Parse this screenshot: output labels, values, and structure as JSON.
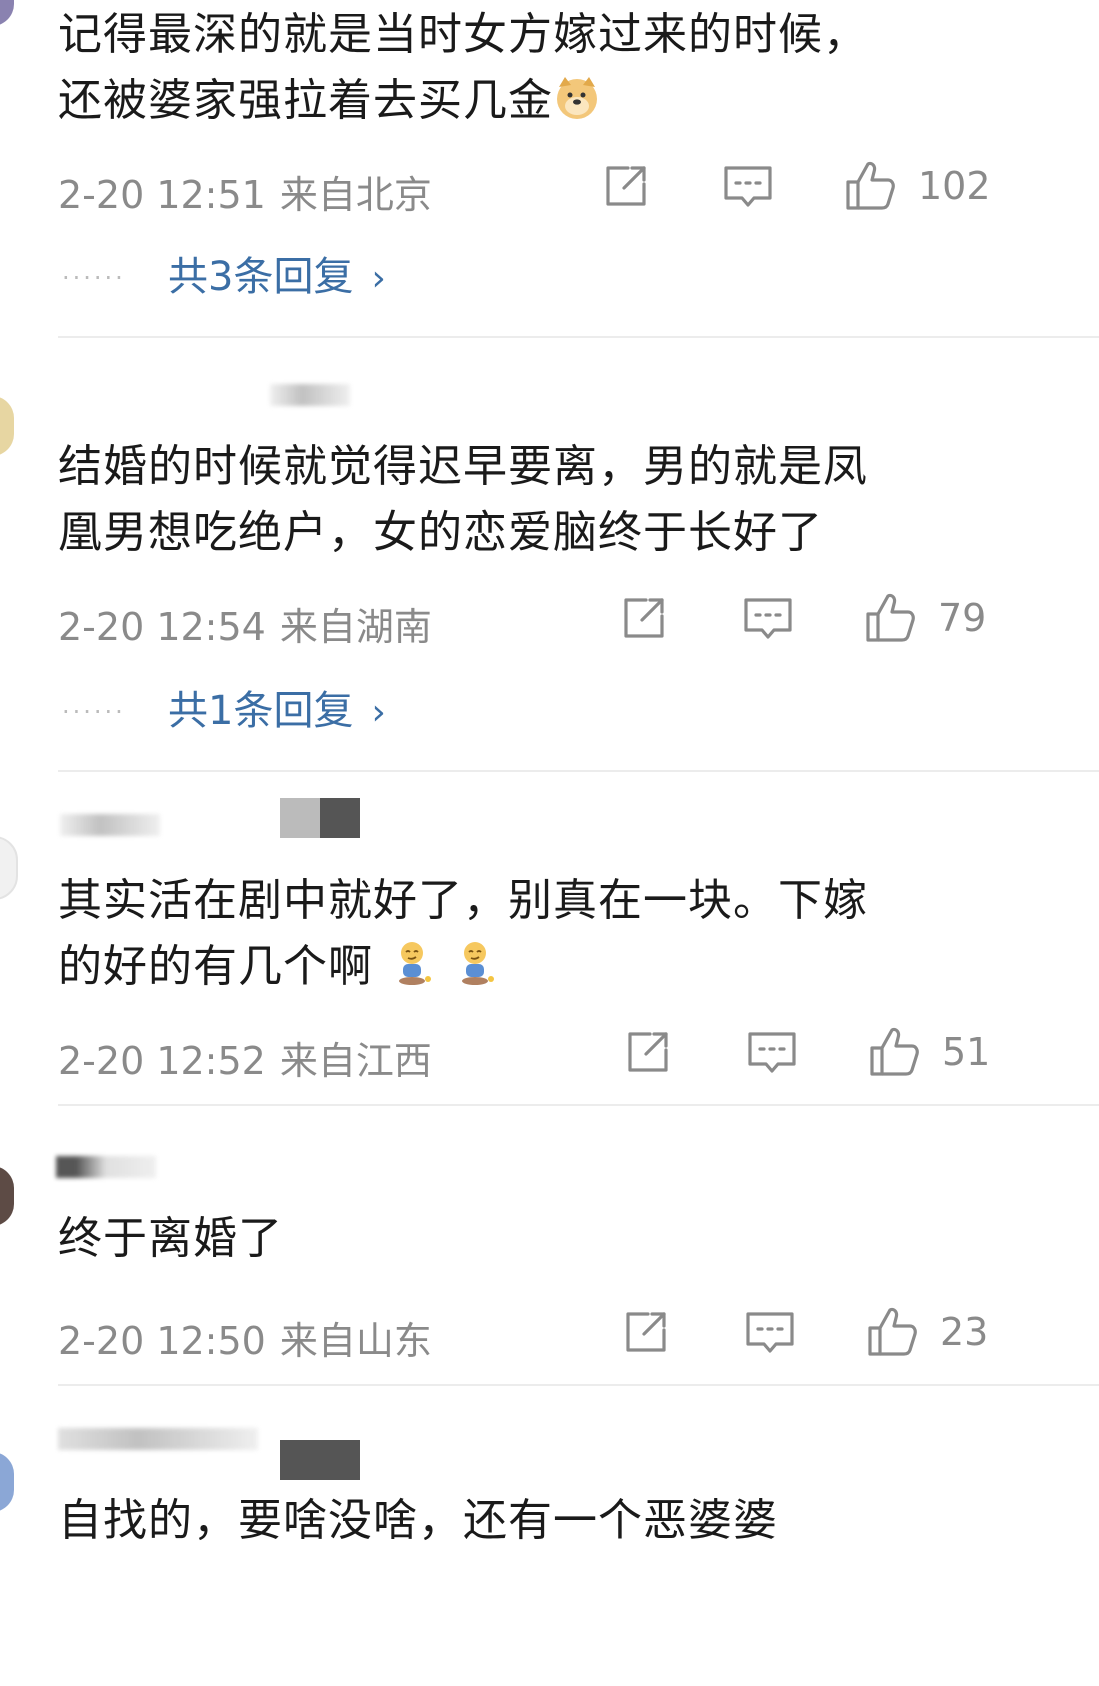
{
  "comments": [
    {
      "text_line1": "记得最深的就是当时女方嫁过来的时候，",
      "text_line2": "还被婆家强拉着去买几金",
      "emoji": "doge-emoji",
      "time": "2-20 12:51",
      "location": "来自北京",
      "likes": "102",
      "replies": "共3条回复"
    },
    {
      "text_line1": "结婚的时候就觉得迟早要离，男的就是凤",
      "text_line2": "凰男想吃绝户，女的恋爱脑终于长好了",
      "time": "2-20 12:54",
      "location": "来自湖南",
      "likes": "79",
      "replies": "共1条回复"
    },
    {
      "text_line1": "其实活在剧中就好了，别真在一块。下嫁",
      "text_line2": "的好的有几个啊",
      "emoji": "smirk-sitting-emoji",
      "time": "2-20 12:52",
      "location": "来自江西",
      "likes": "51"
    },
    {
      "text_line1": "终于离婚了",
      "time": "2-20 12:50",
      "location": "来自山东",
      "likes": "23"
    },
    {
      "text_line1": "自找的，要啥没啥，还有一个恶婆婆"
    }
  ],
  "colors": {
    "meta_gray": "#8a8a8a",
    "reply_blue": "#3b6ea5",
    "divider": "#ececec"
  },
  "icons": [
    "share-icon",
    "comment-icon",
    "like-icon",
    "chevron-right-icon",
    "doge-emoji",
    "smirk-sitting-emoji"
  ]
}
